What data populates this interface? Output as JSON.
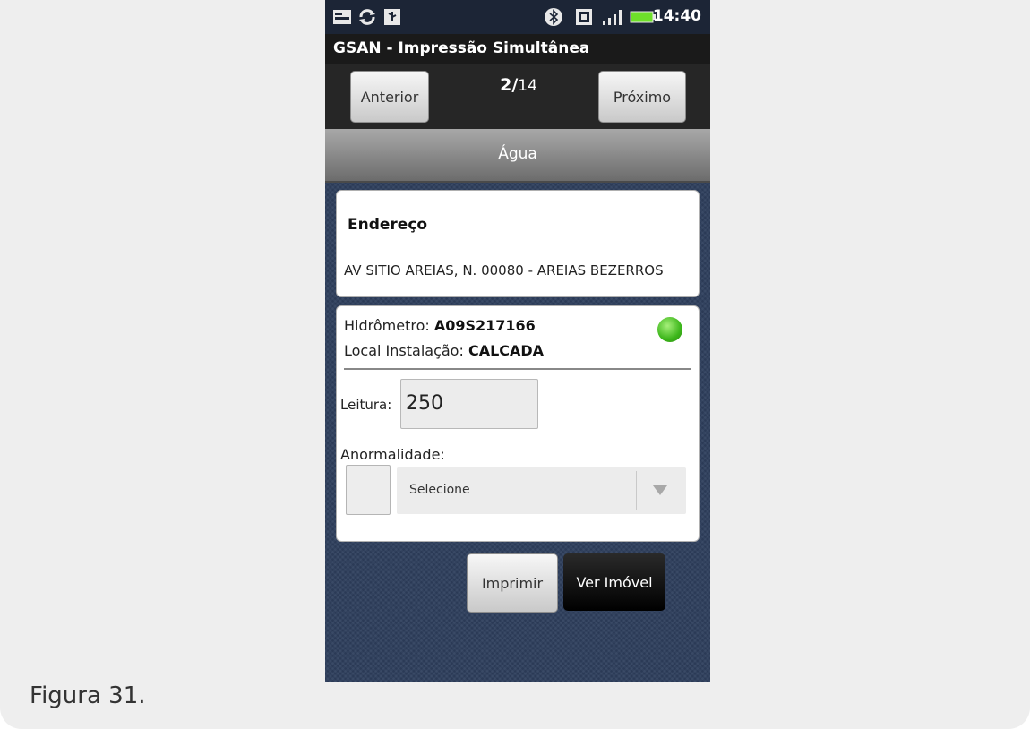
{
  "status_bar": {
    "time": "14:40",
    "left_icons": [
      "notification-icon",
      "sync-icon",
      "usb-icon"
    ],
    "right_icons": [
      "bluetooth-icon",
      "sim-icon",
      "signal-icon",
      "battery-icon"
    ]
  },
  "app": {
    "title": "GSAN - Impressão Simultânea"
  },
  "navigation": {
    "prev_label": "Anterior",
    "next_label": "Próximo",
    "current": "2/",
    "total": "14"
  },
  "section": {
    "title": "Água"
  },
  "address": {
    "label": "Endereço",
    "value": "AV SITIO AREIAS, N. 00080 - AREIAS BEZERROS"
  },
  "meter": {
    "hydrometer_label": "Hidrômetro: ",
    "hydrometer_value": "A09S217166",
    "location_label": "Local Instalação: ",
    "location_value": "CALCADA",
    "status_color": "#3cb61a"
  },
  "reading": {
    "label": "Leitura:",
    "value": "250"
  },
  "anomaly": {
    "label": "Anormalidade:",
    "selected": "Selecione"
  },
  "actions": {
    "print_label": "Imprimir",
    "view_label": "Ver Imóvel"
  },
  "caption": "Figura 31."
}
